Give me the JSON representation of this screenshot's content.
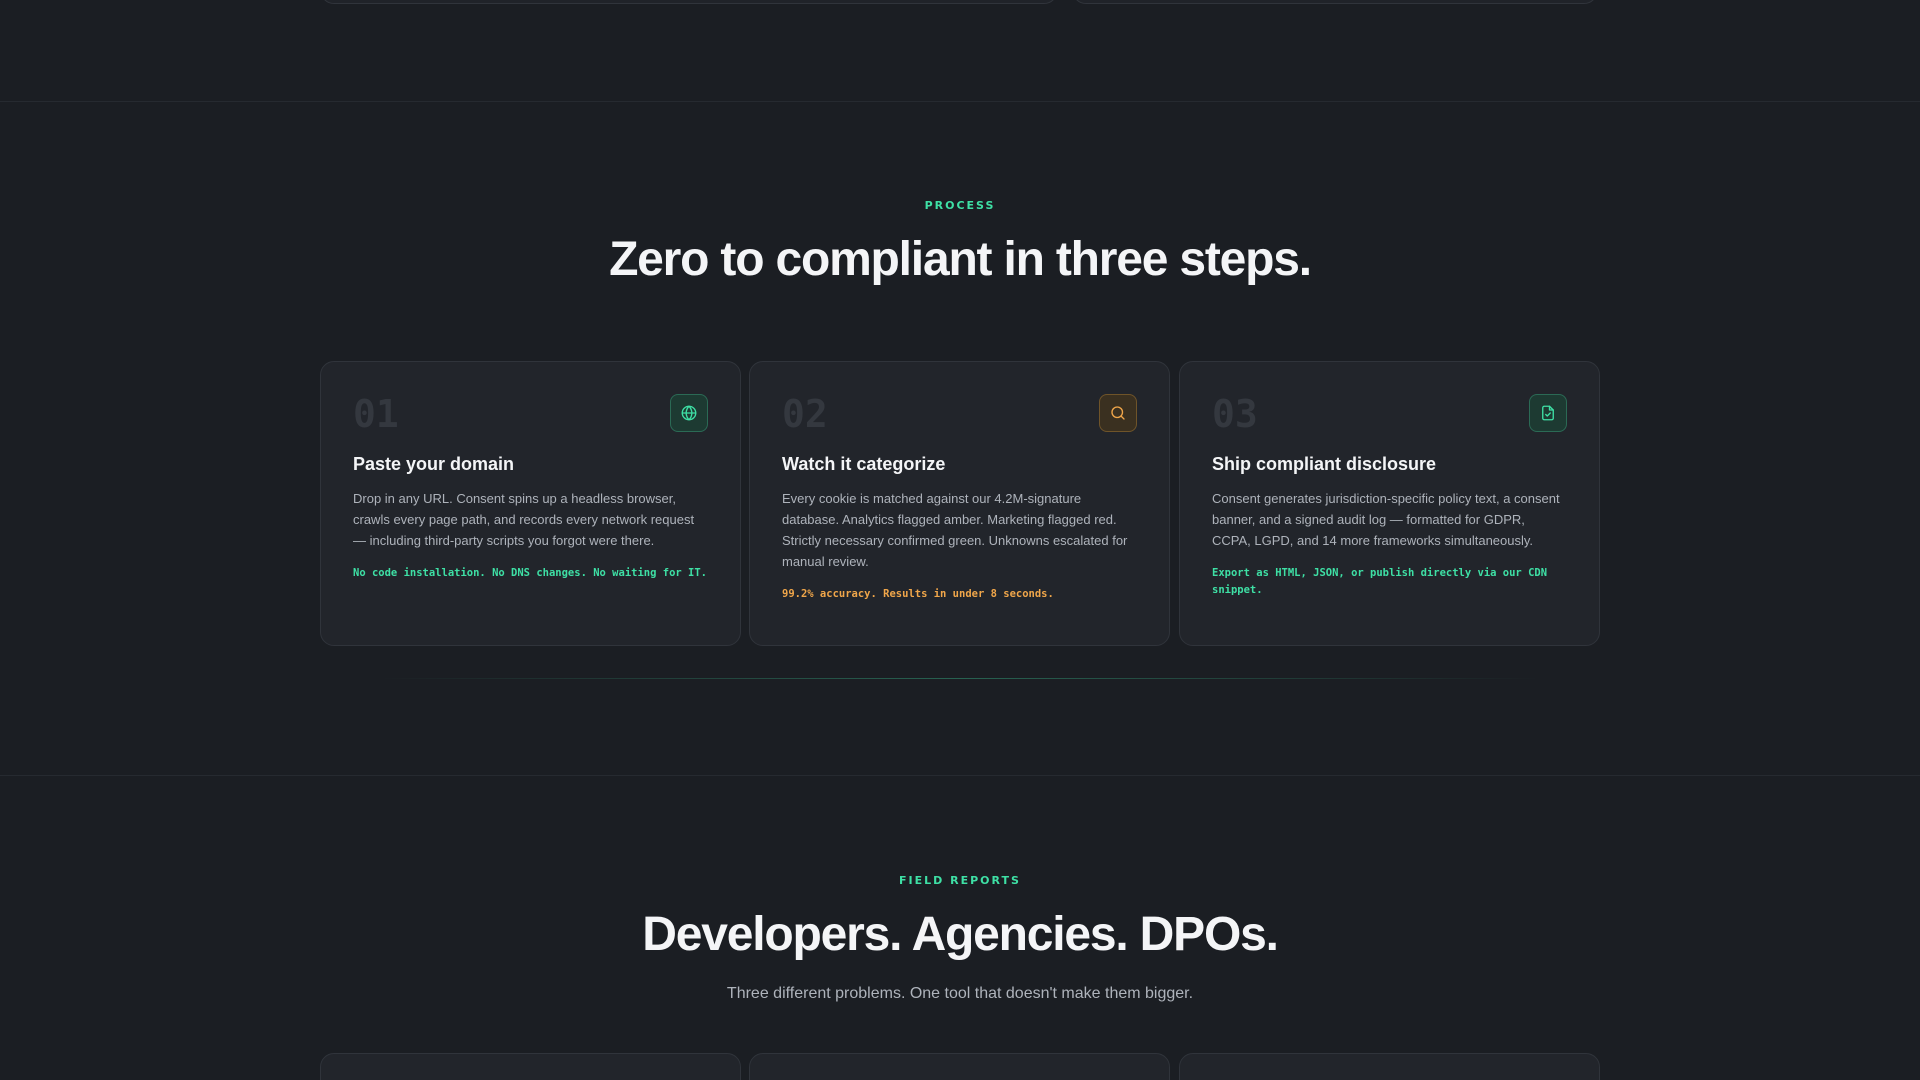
{
  "process": {
    "eyebrow": "PROCESS",
    "heading": "Zero to compliant in three steps.",
    "steps": [
      {
        "number": "01",
        "icon": "globe-icon",
        "title": "Paste your domain",
        "description": "Drop in any URL. Consent spins up a headless browser, crawls every page path, and records every network request — including third-party scripts you forgot were there.",
        "note": "No code installation. No DNS changes. No waiting for IT.",
        "accent": "#3ee0a5"
      },
      {
        "number": "02",
        "icon": "search-icon",
        "title": "Watch it categorize",
        "description": "Every cookie is matched against our 4.2M-signature database. Analytics flagged amber. Marketing flagged red. Strictly necessary confirmed green. Unknowns escalated for manual review.",
        "note": "99.2% accuracy. Results in under 8 seconds.",
        "accent": "#f0a64a"
      },
      {
        "number": "03",
        "icon": "file-check-icon",
        "title": "Ship compliant disclosure",
        "description": "Consent generates jurisdiction-specific policy text, a consent banner, and a signed audit log — formatted for GDPR, CCPA, LGPD, and 14 more frameworks simultaneously.",
        "note": "Export as HTML, JSON, or publish directly via our CDN snippet.",
        "accent": "#3ee0a5"
      }
    ]
  },
  "field_reports": {
    "eyebrow": "FIELD REPORTS",
    "heading": "Developers. Agencies. DPOs.",
    "subheading": "Three different problems. One tool that doesn't make them bigger."
  },
  "colors": {
    "background": "#1b1e23",
    "card": "#22252b",
    "accent_green": "#3ee0a5",
    "accent_amber": "#f0a64a"
  }
}
